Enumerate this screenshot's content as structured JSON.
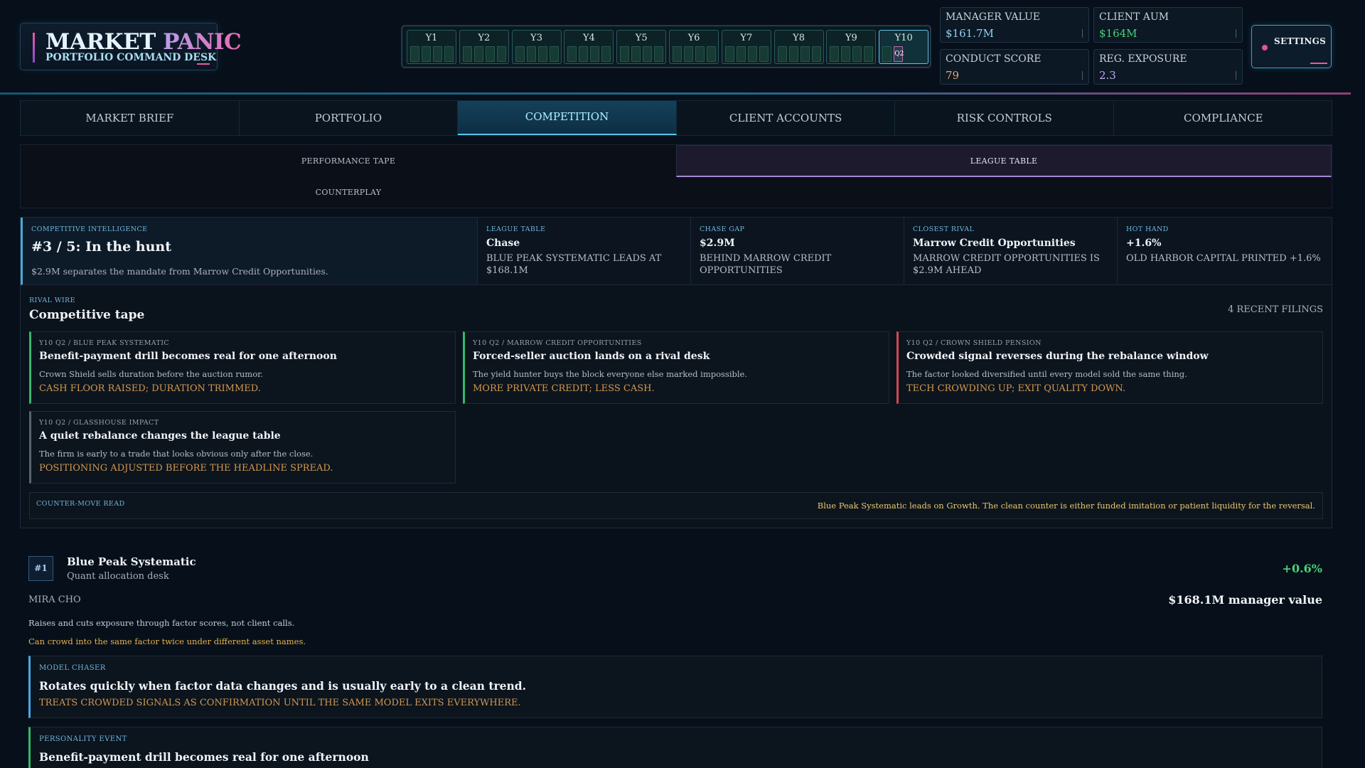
{
  "header": {
    "title_part1": "MARKET ",
    "title_part2": "PANIC",
    "subtitle": "PORTFOLIO COMMAND DESK",
    "years": [
      "Y1",
      "Y2",
      "Y3",
      "Y4",
      "Y5",
      "Y6",
      "Y7",
      "Y8",
      "Y9",
      "Y10"
    ],
    "current_year": "Y10",
    "current_quarter": "Q2",
    "settings_label": "SETTINGS"
  },
  "stats": {
    "manager_value": {
      "label": "MANAGER VALUE",
      "value": "$161.7M",
      "color": "#8ed0f0"
    },
    "client_aum": {
      "label": "CLIENT AUM",
      "value": "$164M",
      "color": "#4ad07a"
    },
    "conduct_score": {
      "label": "CONDUCT SCORE",
      "value": "79",
      "color": "#f0a070"
    },
    "reg_exposure": {
      "label": "REG. EXPOSURE",
      "value": "2.3",
      "color": "#c3a8ec"
    }
  },
  "tabs": [
    "MARKET BRIEF",
    "PORTFOLIO",
    "COMPETITION",
    "CLIENT ACCOUNTS",
    "RISK CONTROLS",
    "COMPLIANCE"
  ],
  "active_tab": "COMPETITION",
  "subtabs": [
    "PERFORMANCE TAPE",
    "LEAGUE TABLE",
    "COUNTERPLAY"
  ],
  "active_subtab": "LEAGUE TABLE",
  "intel": {
    "label": "COMPETITIVE INTELLIGENCE",
    "title": "#3 / 5: In the hunt",
    "subtitle": "$2.9M separates the mandate from Marrow Credit Opportunities.",
    "cards": [
      {
        "label": "LEAGUE TABLE",
        "title": "Chase",
        "desc": "BLUE PEAK SYSTEMATIC LEADS AT $168.1M"
      },
      {
        "label": "CHASE GAP",
        "title": "$2.9M",
        "desc": "BEHIND MARROW CREDIT OPPORTUNITIES"
      },
      {
        "label": "CLOSEST RIVAL",
        "title": "Marrow Credit Opportunities",
        "desc": "MARROW CREDIT OPPORTUNITIES IS $2.9M AHEAD"
      },
      {
        "label": "HOT HAND",
        "title": "+1.6%",
        "desc": "OLD HARBOR CAPITAL PRINTED +1.6%"
      }
    ]
  },
  "rival_wire": {
    "label": "RIVAL WIRE",
    "title": "Competitive tape",
    "count": "4 RECENT FILINGS",
    "items": [
      {
        "tag": "Y10 Q2 / BLUE PEAK SYSTEMATIC",
        "title": "Benefit-payment drill becomes real for one afternoon",
        "body": "Crown Shield sells duration before the auction rumor.",
        "outcome": "CASH FLOOR RAISED; DURATION TRIMMED.",
        "accent": "green"
      },
      {
        "tag": "Y10 Q2 / MARROW CREDIT OPPORTUNITIES",
        "title": "Forced-seller auction lands on a rival desk",
        "body": "The yield hunter buys the block everyone else marked impossible.",
        "outcome": "MORE PRIVATE CREDIT; LESS CASH.",
        "accent": "green"
      },
      {
        "tag": "Y10 Q2 / CROWN SHIELD PENSION",
        "title": "Crowded signal reverses during the rebalance window",
        "body": "The factor looked diversified until every model sold the same thing.",
        "outcome": "TECH CROWDING UP; EXIT QUALITY DOWN.",
        "accent": "red"
      },
      {
        "tag": "Y10 Q2 / GLASSHOUSE IMPACT",
        "title": "A quiet rebalance changes the league table",
        "body": "The firm is early to a trade that looks obvious only after the close.",
        "outcome": "POSITIONING ADJUSTED BEFORE THE HEADLINE SPREAD.",
        "accent": "grey"
      }
    ],
    "counter_label": "COUNTER-MOVE READ",
    "counter_text": "Blue Peak Systematic leads on Growth. The clean counter is either funded imitation or patient liquidity for the reversal."
  },
  "rival": {
    "rank": "#1",
    "name": "Blue Peak Systematic",
    "desk": "Quant allocation desk",
    "change": "+0.6%",
    "manager": "MIRA CHO",
    "value": "$168.1M manager value",
    "desc": "Raises and cuts exposure through factor scores, not client calls.",
    "warning": "Can crowd into the same factor twice under different asset names.",
    "traits": [
      {
        "label": "MODEL CHASER",
        "title": "Rotates quickly when factor data changes and is usually early to a clean trend.",
        "outcome": "TREATS CROWDED SIGNALS AS CONFIRMATION UNTIL THE SAME MODEL EXITS EVERYWHERE."
      },
      {
        "label": "PERSONALITY EVENT",
        "title": "Benefit-payment drill becomes real for one afternoon"
      }
    ]
  }
}
